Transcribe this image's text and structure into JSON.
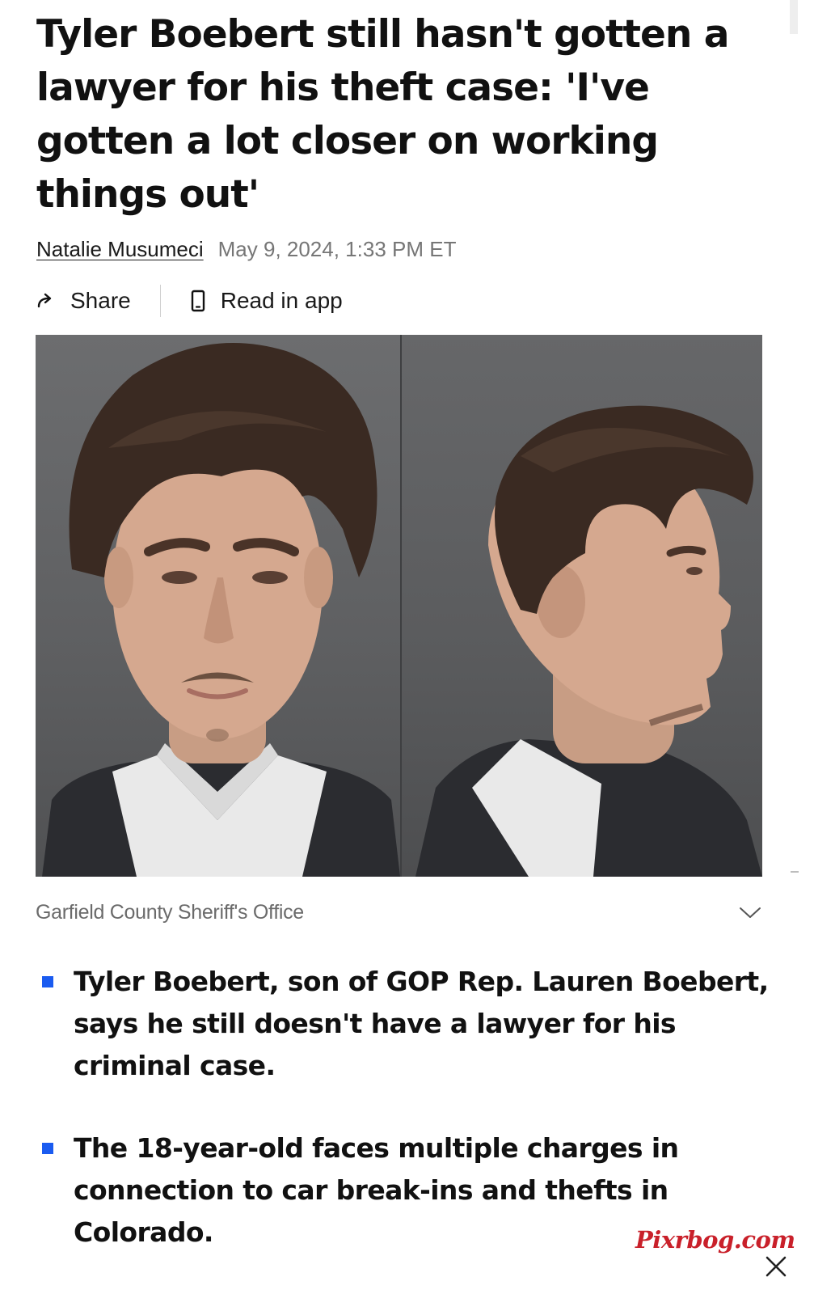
{
  "article": {
    "headline": "Tyler Boebert still hasn't gotten a lawyer for his theft case: 'I've gotten a lot closer on working things out'",
    "author": "Natalie Musumeci",
    "date": "May 9, 2024, 1:33 PM ET"
  },
  "actions": {
    "share_label": "Share",
    "read_in_app_label": "Read in app",
    "share_icon": "share-arrow-icon",
    "app_icon": "phone-icon"
  },
  "image": {
    "credit": "Garfield County Sheriff's Office",
    "expand_icon": "chevron-down-icon"
  },
  "key_points": [
    "Tyler Boebert, son of GOP Rep. Lauren Boebert, says he still doesn't have a lawyer for his criminal case.",
    "The 18-year-old faces multiple charges in connection to car break-ins and thefts in Colorado."
  ],
  "watermark": "Pixrbog.com",
  "colors": {
    "bullet": "#1a5bf0",
    "watermark": "#c9202a",
    "date": "#767676",
    "credit": "#6b6b6b"
  }
}
